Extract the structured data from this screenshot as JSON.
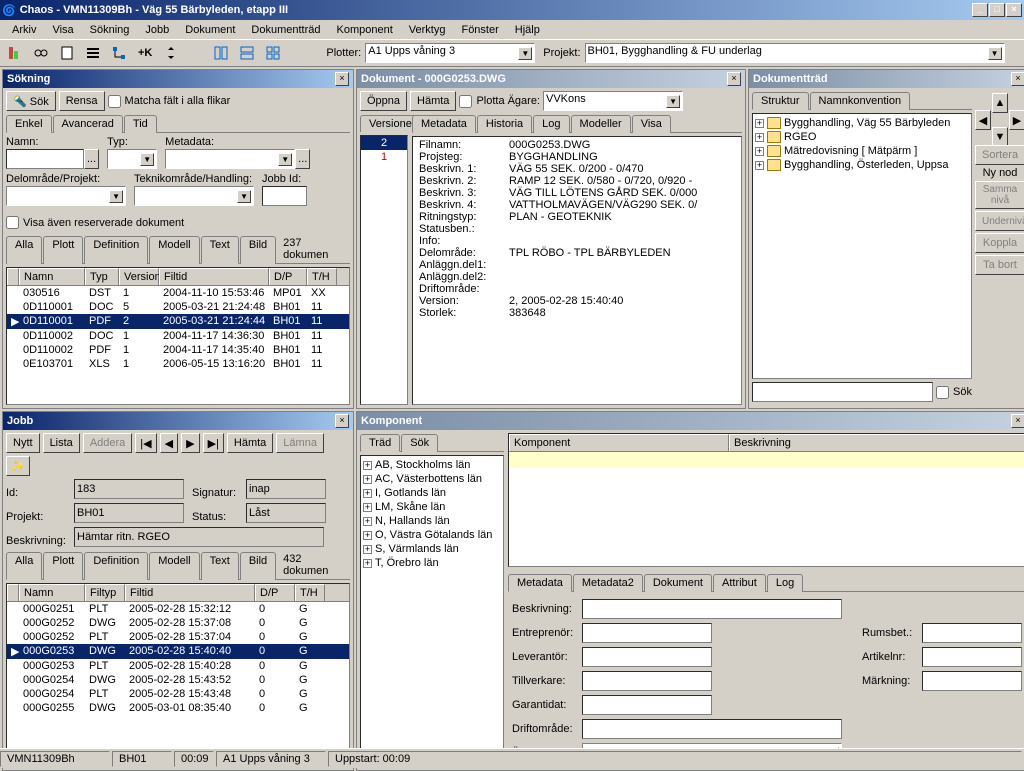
{
  "window": {
    "title": "Chaos - VMN11309Bh - Väg 55 Bärbyleden, etapp III"
  },
  "menu": [
    "Arkiv",
    "Visa",
    "Sökning",
    "Jobb",
    "Dokument",
    "Dokumentträd",
    "Komponent",
    "Verktyg",
    "Fönster",
    "Hjälp"
  ],
  "toolbar": {
    "plotter_label": "Plotter:",
    "plotter_value": "A1 Upps våning 3",
    "projekt_label": "Projekt:",
    "projekt_value": "BH01, Bygghandling & FU underlag"
  },
  "sok": {
    "title": "Sökning",
    "sok_btn": "Sök",
    "rensa_btn": "Rensa",
    "matcha": "Matcha fält i alla flikar",
    "tabs": [
      "Enkel",
      "Avancerad",
      "Tid"
    ],
    "namn": "Namn:",
    "typ": "Typ:",
    "metadata": "Metadata:",
    "delomrade": "Delområde/Projekt:",
    "teknikomrade": "Teknikområde/Handling:",
    "jobid": "Jobb Id:",
    "visa_res": "Visa även reserverade dokument",
    "rtabs": [
      "Alla",
      "Plott",
      "Definition",
      "Modell",
      "Text",
      "Bild"
    ],
    "rcount": "237 dokumen",
    "cols": [
      "Namn",
      "Typ",
      "Version",
      "Filtid",
      "D/P",
      "T/H"
    ],
    "rows": [
      {
        "namn": "030516",
        "typ": "DST",
        "ver": "1",
        "filtid": "2004-11-10 15:53:46",
        "dp": "MP01",
        "th": "XX"
      },
      {
        "namn": "0D110001",
        "typ": "DOC",
        "ver": "5",
        "filtid": "2005-03-21 21:24:48",
        "dp": "BH01",
        "th": "11"
      },
      {
        "namn": "0D110001",
        "typ": "PDF",
        "ver": "2",
        "filtid": "2005-03-21 21:24:44",
        "dp": "BH01",
        "th": "11",
        "sel": true
      },
      {
        "namn": "0D110002",
        "typ": "DOC",
        "ver": "1",
        "filtid": "2004-11-17 14:36:30",
        "dp": "BH01",
        "th": "11"
      },
      {
        "namn": "0D110002",
        "typ": "PDF",
        "ver": "1",
        "filtid": "2004-11-17 14:35:40",
        "dp": "BH01",
        "th": "11"
      },
      {
        "namn": "0E103701",
        "typ": "XLS",
        "ver": "1",
        "filtid": "2006-05-15 13:16:20",
        "dp": "BH01",
        "th": "11"
      }
    ]
  },
  "dok": {
    "title": "Dokument - 000G0253.DWG",
    "oppna": "Öppna",
    "hamta": "Hämta",
    "plotta": "Plotta",
    "agare_lbl": "Ägare:",
    "agare": "VVKons",
    "tabs": [
      "Versioner",
      "Metadata",
      "Historia",
      "Log",
      "Modeller",
      "Visa"
    ],
    "versions": [
      "2",
      "1"
    ],
    "meta": [
      {
        "k": "Filnamn:",
        "v": "000G0253.DWG"
      },
      {
        "k": "Projsteg:",
        "v": "BYGGHANDLING"
      },
      {
        "k": "Beskrivn. 1:",
        "v": "VÄG 55 SEK. 0/200 - 0/470"
      },
      {
        "k": "Beskrivn. 2:",
        "v": "RAMP 12 SEK. 0/580 - 0/720, 0/920 -"
      },
      {
        "k": "Beskrivn. 3:",
        "v": "VÄG TILL LÖTENS GÅRD SEK. 0/000"
      },
      {
        "k": "Beskrivn. 4:",
        "v": "VATTHOLMAVÄGEN/VÄG290 SEK. 0/"
      },
      {
        "k": "Ritningstyp:",
        "v": "PLAN - GEOTEKNIK"
      },
      {
        "k": "Statusben.:",
        "v": ""
      },
      {
        "k": "Info:",
        "v": ""
      },
      {
        "k": "Delområde:",
        "v": "TPL RÖBO - TPL BÄRBYLEDEN"
      },
      {
        "k": "Anläggn.del1:",
        "v": ""
      },
      {
        "k": "Anläggn.del2:",
        "v": ""
      },
      {
        "k": "Driftområde:",
        "v": ""
      },
      {
        "k": "Version:",
        "v": "2, 2005-02-28 15:40:40"
      },
      {
        "k": "Storlek:",
        "v": "383648"
      }
    ]
  },
  "trad": {
    "title": "Dokumentträd",
    "tabs": [
      "Struktur",
      "Namnkonvention"
    ],
    "items": [
      "Bygghandling, Väg 55 Bärbyleden",
      "RGEO",
      "Mätredovisning [ Mätpärm ]",
      "Bygghandling, Österleden, Uppsa"
    ],
    "side": [
      "Sortera",
      "Ny nod",
      "Samma nivå",
      "Undernivå",
      "Koppla",
      "Ta bort"
    ],
    "sok": "Sök"
  },
  "jobb": {
    "title": "Jobb",
    "nytt": "Nytt",
    "lista": "Lista",
    "addera": "Addera",
    "hamta": "Hämta",
    "lamna": "Lämna",
    "id_lbl": "Id:",
    "id": "183",
    "signatur_lbl": "Signatur:",
    "signatur": "inap",
    "projekt_lbl": "Projekt:",
    "projekt": "BH01",
    "status_lbl": "Status:",
    "status": "Låst",
    "beskrivning_lbl": "Beskrivning:",
    "beskrivning": "Hämtar ritn. RGEO",
    "rtabs": [
      "Alla",
      "Plott",
      "Definition",
      "Modell",
      "Text",
      "Bild"
    ],
    "rcount": "432 dokumen",
    "cols": [
      "Namn",
      "Filtyp",
      "Filtid",
      "D/P",
      "T/H"
    ],
    "rows": [
      {
        "n": "000G0251",
        "t": "PLT",
        "f": "2005-02-28 15:32:12",
        "d": "0",
        "h": "G"
      },
      {
        "n": "000G0252",
        "t": "DWG",
        "f": "2005-02-28 15:37:08",
        "d": "0",
        "h": "G"
      },
      {
        "n": "000G0252",
        "t": "PLT",
        "f": "2005-02-28 15:37:04",
        "d": "0",
        "h": "G"
      },
      {
        "n": "000G0253",
        "t": "DWG",
        "f": "2005-02-28 15:40:40",
        "d": "0",
        "h": "G",
        "sel": true
      },
      {
        "n": "000G0253",
        "t": "PLT",
        "f": "2005-02-28 15:40:28",
        "d": "0",
        "h": "G"
      },
      {
        "n": "000G0254",
        "t": "DWG",
        "f": "2005-02-28 15:43:52",
        "d": "0",
        "h": "G"
      },
      {
        "n": "000G0254",
        "t": "PLT",
        "f": "2005-02-28 15:43:48",
        "d": "0",
        "h": "G"
      },
      {
        "n": "000G0255",
        "t": "DWG",
        "f": "2005-03-01 08:35:40",
        "d": "0",
        "h": "G"
      }
    ]
  },
  "komp": {
    "title": "Komponent",
    "tabs": [
      "Träd",
      "Sök"
    ],
    "tree": [
      "AB, Stockholms län",
      "AC, Västerbottens län",
      "I, Gotlands län",
      "LM, Skåne län",
      "N, Hallands län",
      "O, Västra Götalands län",
      "S, Värmlands län",
      "T, Örebro län"
    ],
    "head": [
      "Komponent",
      "Beskrivning"
    ],
    "mtabs": [
      "Metadata",
      "Metadata2",
      "Dokument",
      "Attribut",
      "Log"
    ],
    "fields_l": [
      "Beskrivning:",
      "Entreprenör:",
      "Leverantör:",
      "Tillverkare:",
      "Garantidat:",
      "Driftområde:",
      "Ägare:"
    ],
    "fields_r": [
      "Rumsbet.:",
      "Artikelnr:",
      "Märkning:"
    ]
  },
  "status": {
    "a": "VMN11309Bh",
    "b": "BH01",
    "c": "00:09",
    "d": "A1 Upps våning 3",
    "e": "Uppstart: 00:09"
  }
}
